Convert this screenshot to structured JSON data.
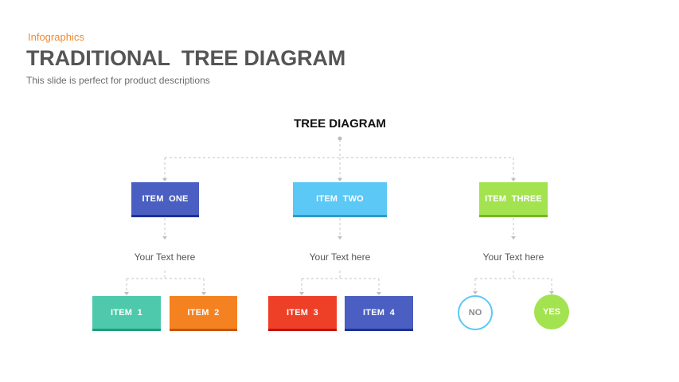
{
  "header": {
    "eyebrow": "Infographics",
    "title": "TRADITIONAL  TREE DIAGRAM",
    "subtitle": "This slide is perfect for product descriptions"
  },
  "tree": {
    "root": "TREE DIAGRAM",
    "branches": [
      {
        "label": "ITEM  ONE",
        "color": "#4a5fc1",
        "caption": "Your Text here",
        "children": [
          {
            "label": "ITEM  1",
            "color": "#4fc9ab"
          },
          {
            "label": "ITEM  2",
            "color": "#f58220"
          }
        ]
      },
      {
        "label": "ITEM  TWO",
        "color": "#5bc8f5",
        "caption": "Your Text here",
        "children": [
          {
            "label": "ITEM  3",
            "color": "#ee4027"
          },
          {
            "label": "ITEM  4",
            "color": "#4a5fc1"
          }
        ]
      },
      {
        "label": "ITEM  THREE",
        "color": "#a3e34f",
        "caption": "Your Text here",
        "children": [
          {
            "label": "NO",
            "color": "#5bc8f5",
            "style": "outline"
          },
          {
            "label": "YES",
            "color": "#a3e34f",
            "style": "filled"
          }
        ]
      }
    ]
  }
}
